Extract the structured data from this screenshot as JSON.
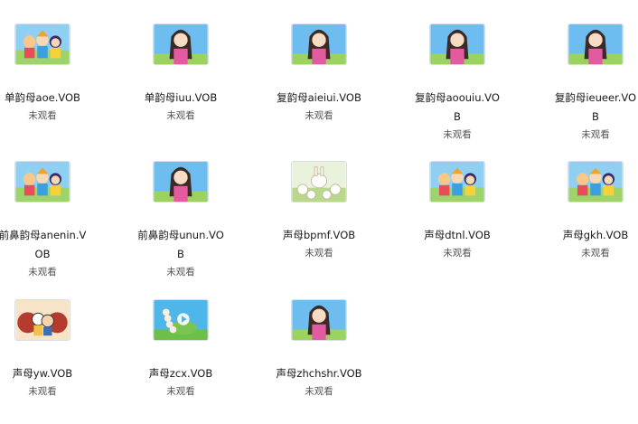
{
  "files": [
    {
      "name": "单韵母aoe.VOB",
      "status": "未观看",
      "icon": "kids-trio-thumbnail"
    },
    {
      "name": "单韵母iuu.VOB",
      "status": "未观看",
      "icon": "girl-teacher-thumbnail"
    },
    {
      "name": "复韵母aieiui.VOB",
      "status": "未观看",
      "icon": "girl-teacher-thumbnail"
    },
    {
      "name": "复韵母aoouiu.VOB",
      "status": "未观看",
      "icon": "girl-teacher-thumbnail"
    },
    {
      "name": "复韵母ieueer.VOB",
      "status": "未观看",
      "icon": "girl-teacher-thumbnail"
    },
    {
      "name": "前鼻韵母anenin.VOB",
      "status": "未观看",
      "icon": "kids-trio-thumbnail"
    },
    {
      "name": "前鼻韵母unun.VOB",
      "status": "未观看",
      "icon": "girl-teacher-thumbnail"
    },
    {
      "name": "声母bpmf.VOB",
      "status": "未观看",
      "icon": "bunny-group-thumbnail"
    },
    {
      "name": "声母dtnl.VOB",
      "status": "未观看",
      "icon": "kids-trio-thumbnail"
    },
    {
      "name": "声母gkh.VOB",
      "status": "未观看",
      "icon": "kids-trio-thumbnail"
    },
    {
      "name": "声母yw.VOB",
      "status": "未观看",
      "icon": "cartoon-kids-thumbnail"
    },
    {
      "name": "声母zcx.VOB",
      "status": "未观看",
      "icon": "play-caterpillar-thumbnail"
    },
    {
      "name": "声母zhchshr.VOB",
      "status": "未观看",
      "icon": "girl-teacher-thumbnail"
    }
  ]
}
